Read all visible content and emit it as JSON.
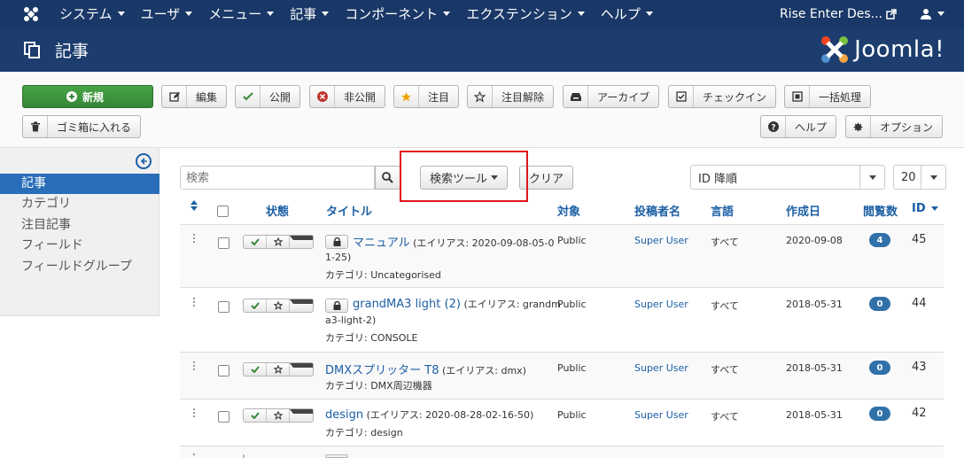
{
  "topnav": {
    "menus": [
      "システム",
      "ユーザ",
      "メニュー",
      "記事",
      "コンポーネント",
      "エクステンション",
      "ヘルプ"
    ],
    "site_name": "Rise Enter Des..."
  },
  "header": {
    "title": "記事",
    "logo_text": "Joomla!"
  },
  "toolbar": {
    "new": "新規",
    "edit": "編集",
    "publish": "公開",
    "unpublish": "非公開",
    "feature": "注目",
    "unfeature": "注目解除",
    "archive": "アーカイブ",
    "checkin": "チェックイン",
    "batch": "一括処理",
    "trash": "ゴミ箱に入れる",
    "help": "ヘルプ",
    "options": "オプション"
  },
  "sidebar": {
    "items": [
      "記事",
      "カテゴリ",
      "注目記事",
      "フィールド",
      "フィールドグループ"
    ]
  },
  "filters": {
    "search_placeholder": "検索",
    "search_tools": "検索ツール",
    "clear": "クリア",
    "ordering": "ID 降順",
    "limit": "20"
  },
  "table": {
    "headers": {
      "status": "状態",
      "title": "タイトル",
      "access": "対象",
      "author": "投稿者名",
      "language": "言語",
      "created": "作成日",
      "hits": "閲覧数",
      "id": "ID"
    },
    "rows": [
      {
        "title": "マニュアル",
        "alias_line1": "(エイリアス: 2020-09-08-05-0",
        "alias_line2": "1-25)",
        "category": "カテゴリ: Uncategorised",
        "access": "Public",
        "author": "Super User",
        "language": "すべて",
        "created": "2020-09-08",
        "hits": "4",
        "id": "45"
      },
      {
        "title": "grandMA3 light (2)",
        "alias_line1": "(エイリアス: grandm",
        "alias_line2": "a3-light-2)",
        "category": "カテゴリ: CONSOLE",
        "access": "Public",
        "author": "Super User",
        "language": "すべて",
        "created": "2018-05-31",
        "hits": "0",
        "id": "44"
      },
      {
        "title": "DMXスプリッター T8",
        "alias_line1": "(エイリアス: dmx)",
        "alias_line2": "",
        "category": "カテゴリ: DMX周辺機器",
        "access": "Public",
        "author": "Super User",
        "language": "すべて",
        "created": "2018-05-31",
        "hits": "0",
        "id": "43"
      },
      {
        "title": "design",
        "alias_line1": "(エイリアス: 2020-08-28-02-16-50)",
        "alias_line2": "",
        "category": "カテゴリ: design",
        "access": "Public",
        "author": "Super User",
        "language": "すべて",
        "created": "2018-05-31",
        "hits": "0",
        "id": "42"
      }
    ]
  },
  "colors": {
    "topnav": "#1a3867",
    "header": "#1c3d6e",
    "link": "#1c5fa5",
    "new_button": "#46a546",
    "sidebar_active": "#2a6db8",
    "highlight": "#e0161a"
  }
}
